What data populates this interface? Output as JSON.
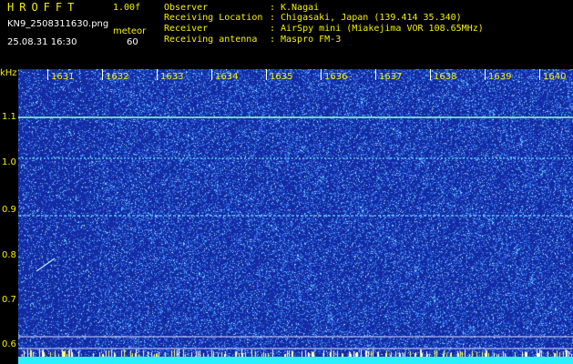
{
  "header": {
    "title": "HROFFT",
    "version": "1.00f",
    "filename": "KN9_2508311630.png",
    "meteor_label": "meteor",
    "datetime": "25.08.31 16:30",
    "meteor_count": "60",
    "info": [
      {
        "label": "Observer",
        "sep": ":",
        "value": "K.Nagai"
      },
      {
        "label": "Receiving Location",
        "sep": ":",
        "value": "Chigasaki, Japan (139.414 35.340)"
      },
      {
        "label": "Receiver",
        "sep": ":",
        "value": "AirSpy mini (Miakejima VOR 108.65MHz)"
      },
      {
        "label": "Receiving antenna",
        "sep": ":",
        "value": "Maspro FM-3"
      }
    ]
  },
  "spectrogram": {
    "y_unit": "kHz",
    "y_ticks": [
      "1.1",
      "1.0",
      "0.9",
      "0.8",
      "0.7",
      "0.6"
    ],
    "x_ticks": [
      "1631",
      "1632",
      "1633",
      "1634",
      "1635",
      "1636",
      "1637",
      "1638",
      "1639",
      "1640"
    ],
    "colors": {
      "background": "#1a2a9a",
      "noise": "#3a7aff",
      "signal": "#7fffd0",
      "axis_text": "#f4f000"
    }
  }
}
